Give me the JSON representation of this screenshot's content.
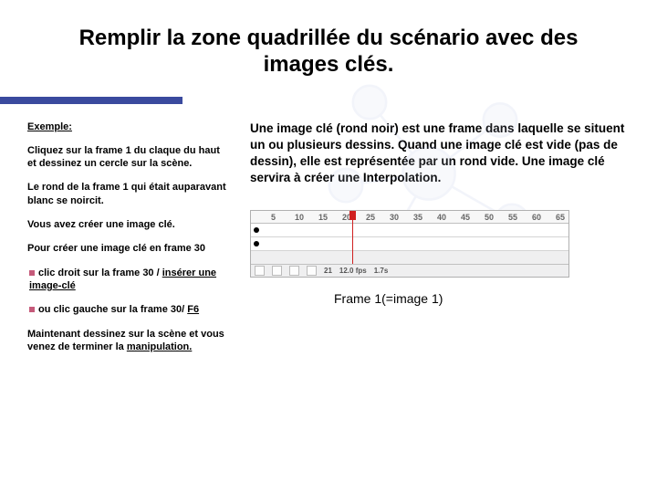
{
  "title": "Remplir la zone quadrillée du scénario avec des images clés.",
  "left": {
    "exemple": "Exemple:",
    "p1": "Cliquez sur la frame 1 du claque du haut et dessinez un cercle sur la scène.",
    "p2": "Le rond de la frame 1 qui était auparavant blanc se noircit.",
    "p3": "Vous avez créer une image clé.",
    "p4": "Pour créer une image clé en frame 30",
    "b1_pre": "clic droit sur la frame 30 / ",
    "b1_u": "insérer une image-clé",
    "b2_pre": "ou clic gauche sur la frame 30/ ",
    "b2_u": "F6",
    "p5_pre": "Maintenant dessinez sur la scène et vous venez de terminer la ",
    "p5_u": "manipulation."
  },
  "right": {
    "desc": "Une image clé (rond noir) est une frame dans laquelle se situent un ou plusieurs dessins. Quand une image clé est vide (pas de dessin), elle est représentée par un rond vide. Une image clé servira à créer une Interpolation.",
    "caption": "Frame 1(=image 1)"
  },
  "timeline": {
    "ticks": [
      "5",
      "10",
      "15",
      "20",
      "25",
      "30",
      "35",
      "40",
      "45",
      "50",
      "55",
      "60",
      "65"
    ],
    "footer_frame": "21",
    "footer_fps": "12.0 fps",
    "footer_time": "1.7s"
  }
}
